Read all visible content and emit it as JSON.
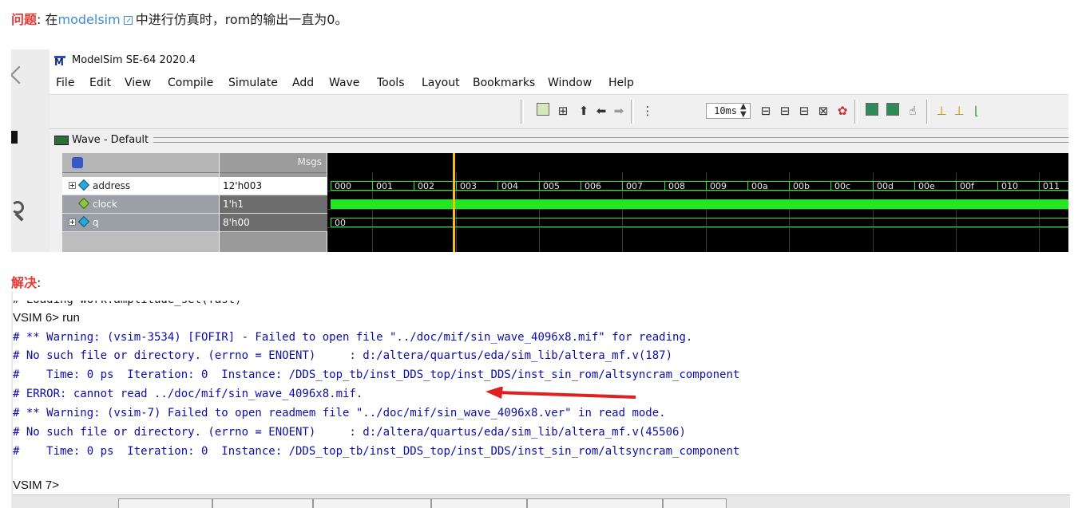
{
  "question": {
    "label": "问题",
    "colon": ": ",
    "prefix": "在",
    "link_text": "modelsim",
    "link_icon": "external-link-icon",
    "suffix": "中进行仿真时，rom的输出一直为0。"
  },
  "modelsim": {
    "title": "ModelSim SE-64 2020.4",
    "logo_letter": "M",
    "menu": [
      "File",
      "Edit",
      "View",
      "Compile",
      "Simulate",
      "Add",
      "Wave",
      "Tools",
      "Layout",
      "Bookmarks",
      "Window",
      "Help"
    ],
    "toolbar": {
      "time_value": "10ms"
    },
    "wave_window_title": "Wave - Default",
    "msgs_header": "Msgs",
    "signals": [
      {
        "name": "address",
        "value": "12'h003"
      },
      {
        "name": "clock",
        "value": "1'h1"
      },
      {
        "name": "q",
        "value": "8'h00"
      }
    ],
    "address_values": [
      "000",
      "001",
      "002",
      "003",
      "004",
      "005",
      "006",
      "007",
      "008",
      "009",
      "00a",
      "00b",
      "00c",
      "00d",
      "00e",
      "00f",
      "010",
      "011"
    ],
    "q_value": "00",
    "colors": {
      "wave_bg": "#000000",
      "signal": "#2ee62e",
      "cursor": "#f3c10e"
    }
  },
  "answer": {
    "label": "解决",
    "colon": ":"
  },
  "transcript": {
    "cut_line": "# Loading work.amplitude_sel(fast)",
    "lines": [
      "VSIM 6> run",
      "# ** Warning: (vsim-3534) [FOFIR] - Failed to open file \"../doc/mif/sin_wave_4096x8.mif\" for reading.",
      "# No such file or directory. (errno = ENOENT)     : d:/altera/quartus/eda/sim_lib/altera_mf.v(187)",
      "#    Time: 0 ps  Iteration: 0  Instance: /DDS_top_tb/inst_DDS_top/inst_DDS/inst_sin_rom/altsyncram_component",
      "# ERROR: cannot read ../doc/mif/sin_wave_4096x8.mif.",
      "# ** Warning: (vsim-7) Failed to open readmem file \"../doc/mif/sin_wave_4096x8.ver\" in read mode.",
      "# No such file or directory. (errno = ENOENT)     : d:/altera/quartus/eda/sim_lib/altera_mf.v(45506)",
      "#    Time: 0 ps  Iteration: 0  Instance: /DDS_top_tb/inst_DDS_top/inst_DDS/inst_sin_rom/altsyncram_component"
    ],
    "prompt_end": "VSIM 7>",
    "arrow_color": "#e02020"
  }
}
